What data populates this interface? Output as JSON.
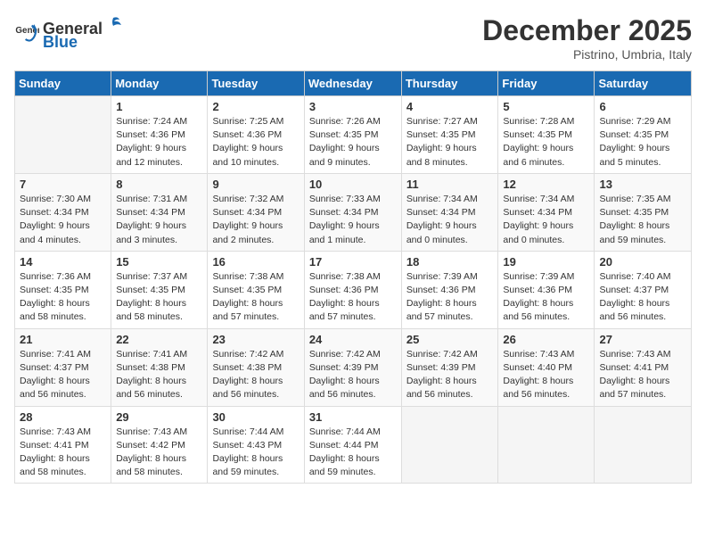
{
  "logo": {
    "text_general": "General",
    "text_blue": "Blue"
  },
  "title": "December 2025",
  "subtitle": "Pistrino, Umbria, Italy",
  "days_of_week": [
    "Sunday",
    "Monday",
    "Tuesday",
    "Wednesday",
    "Thursday",
    "Friday",
    "Saturday"
  ],
  "weeks": [
    [
      {
        "day": "",
        "info": ""
      },
      {
        "day": "1",
        "info": "Sunrise: 7:24 AM\nSunset: 4:36 PM\nDaylight: 9 hours\nand 12 minutes."
      },
      {
        "day": "2",
        "info": "Sunrise: 7:25 AM\nSunset: 4:36 PM\nDaylight: 9 hours\nand 10 minutes."
      },
      {
        "day": "3",
        "info": "Sunrise: 7:26 AM\nSunset: 4:35 PM\nDaylight: 9 hours\nand 9 minutes."
      },
      {
        "day": "4",
        "info": "Sunrise: 7:27 AM\nSunset: 4:35 PM\nDaylight: 9 hours\nand 8 minutes."
      },
      {
        "day": "5",
        "info": "Sunrise: 7:28 AM\nSunset: 4:35 PM\nDaylight: 9 hours\nand 6 minutes."
      },
      {
        "day": "6",
        "info": "Sunrise: 7:29 AM\nSunset: 4:35 PM\nDaylight: 9 hours\nand 5 minutes."
      }
    ],
    [
      {
        "day": "7",
        "info": "Sunrise: 7:30 AM\nSunset: 4:34 PM\nDaylight: 9 hours\nand 4 minutes."
      },
      {
        "day": "8",
        "info": "Sunrise: 7:31 AM\nSunset: 4:34 PM\nDaylight: 9 hours\nand 3 minutes."
      },
      {
        "day": "9",
        "info": "Sunrise: 7:32 AM\nSunset: 4:34 PM\nDaylight: 9 hours\nand 2 minutes."
      },
      {
        "day": "10",
        "info": "Sunrise: 7:33 AM\nSunset: 4:34 PM\nDaylight: 9 hours\nand 1 minute."
      },
      {
        "day": "11",
        "info": "Sunrise: 7:34 AM\nSunset: 4:34 PM\nDaylight: 9 hours\nand 0 minutes."
      },
      {
        "day": "12",
        "info": "Sunrise: 7:34 AM\nSunset: 4:34 PM\nDaylight: 9 hours\nand 0 minutes."
      },
      {
        "day": "13",
        "info": "Sunrise: 7:35 AM\nSunset: 4:35 PM\nDaylight: 8 hours\nand 59 minutes."
      }
    ],
    [
      {
        "day": "14",
        "info": "Sunrise: 7:36 AM\nSunset: 4:35 PM\nDaylight: 8 hours\nand 58 minutes."
      },
      {
        "day": "15",
        "info": "Sunrise: 7:37 AM\nSunset: 4:35 PM\nDaylight: 8 hours\nand 58 minutes."
      },
      {
        "day": "16",
        "info": "Sunrise: 7:38 AM\nSunset: 4:35 PM\nDaylight: 8 hours\nand 57 minutes."
      },
      {
        "day": "17",
        "info": "Sunrise: 7:38 AM\nSunset: 4:36 PM\nDaylight: 8 hours\nand 57 minutes."
      },
      {
        "day": "18",
        "info": "Sunrise: 7:39 AM\nSunset: 4:36 PM\nDaylight: 8 hours\nand 57 minutes."
      },
      {
        "day": "19",
        "info": "Sunrise: 7:39 AM\nSunset: 4:36 PM\nDaylight: 8 hours\nand 56 minutes."
      },
      {
        "day": "20",
        "info": "Sunrise: 7:40 AM\nSunset: 4:37 PM\nDaylight: 8 hours\nand 56 minutes."
      }
    ],
    [
      {
        "day": "21",
        "info": "Sunrise: 7:41 AM\nSunset: 4:37 PM\nDaylight: 8 hours\nand 56 minutes."
      },
      {
        "day": "22",
        "info": "Sunrise: 7:41 AM\nSunset: 4:38 PM\nDaylight: 8 hours\nand 56 minutes."
      },
      {
        "day": "23",
        "info": "Sunrise: 7:42 AM\nSunset: 4:38 PM\nDaylight: 8 hours\nand 56 minutes."
      },
      {
        "day": "24",
        "info": "Sunrise: 7:42 AM\nSunset: 4:39 PM\nDaylight: 8 hours\nand 56 minutes."
      },
      {
        "day": "25",
        "info": "Sunrise: 7:42 AM\nSunset: 4:39 PM\nDaylight: 8 hours\nand 56 minutes."
      },
      {
        "day": "26",
        "info": "Sunrise: 7:43 AM\nSunset: 4:40 PM\nDaylight: 8 hours\nand 56 minutes."
      },
      {
        "day": "27",
        "info": "Sunrise: 7:43 AM\nSunset: 4:41 PM\nDaylight: 8 hours\nand 57 minutes."
      }
    ],
    [
      {
        "day": "28",
        "info": "Sunrise: 7:43 AM\nSunset: 4:41 PM\nDaylight: 8 hours\nand 58 minutes."
      },
      {
        "day": "29",
        "info": "Sunrise: 7:43 AM\nSunset: 4:42 PM\nDaylight: 8 hours\nand 58 minutes."
      },
      {
        "day": "30",
        "info": "Sunrise: 7:44 AM\nSunset: 4:43 PM\nDaylight: 8 hours\nand 59 minutes."
      },
      {
        "day": "31",
        "info": "Sunrise: 7:44 AM\nSunset: 4:44 PM\nDaylight: 8 hours\nand 59 minutes."
      },
      {
        "day": "",
        "info": ""
      },
      {
        "day": "",
        "info": ""
      },
      {
        "day": "",
        "info": ""
      }
    ]
  ]
}
